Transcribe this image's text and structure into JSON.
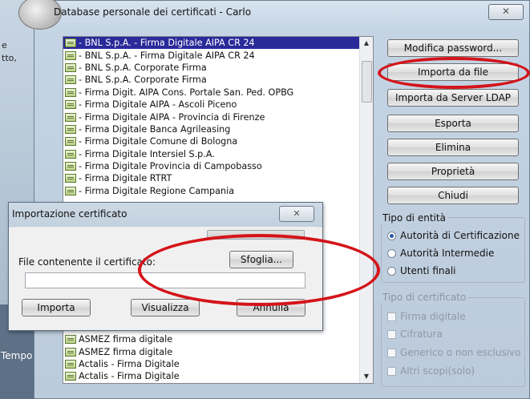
{
  "background": {
    "text_1": "e",
    "text_2": "tto,",
    "taskbar_text": "Tempo"
  },
  "dialog": {
    "title": "Database personale dei certificati - Carlo",
    "close_glyph": "✕"
  },
  "certificates": [
    "- BNL S.p.A. - Firma Digitale AIPA CR 24",
    "- BNL S.p.A. - Firma Digitale AIPA CR 24",
    "- BNL S.p.A. Corporate Firma",
    "- BNL S.p.A. Corporate Firma",
    "- Firma Digit. AIPA Cons. Portale San. Ped. OPBG",
    "- Firma Digitale AIPA - Ascoli Piceno",
    "- Firma Digitale AIPA - Provincia di Firenze",
    "- Firma Digitale Banca Agrileasing",
    "- Firma Digitale Comune di Bologna",
    "- Firma Digitale Intersiel S.p.A.",
    "- Firma Digitale Provincia di Campobasso",
    "- Firma Digitale RTRT",
    "- Firma Digitale Regione Campania"
  ],
  "certificates_bottom": [
    "ASMEZ firma digitale",
    "ASMEZ firma digitale",
    "Actalis - Firma Digitale",
    "Actalis - Firma Digitale"
  ],
  "buttons": {
    "change_password": "Modifica password...",
    "import_file": "Importa da file",
    "import_ldap": "Importa da Server LDAP",
    "export": "Esporta",
    "delete": "Elimina",
    "properties": "Proprietà",
    "close": "Chiudi"
  },
  "entity_type": {
    "title": "Tipo di entità",
    "options": [
      "Autorità di Certificazione",
      "Autorità Intermedie",
      "Utenti finali"
    ],
    "selected": "Autorità di Certificazione"
  },
  "cert_type": {
    "title": "Tipo di certificato",
    "options": [
      "Firma digitale",
      "Cifratura",
      "Generico o non esclusivo",
      "Altri scopi(solo)"
    ]
  },
  "import_dialog": {
    "title": "Importazione certificato",
    "close_glyph": "✕",
    "file_label": "File contenente il certificato:",
    "browse": "Sfoglia...",
    "file_value": "",
    "import": "Importa",
    "view": "Visualizza",
    "cancel": "Annulla"
  },
  "colors": {
    "highlight": "#d4141a",
    "selection": "#2a2a9a"
  }
}
